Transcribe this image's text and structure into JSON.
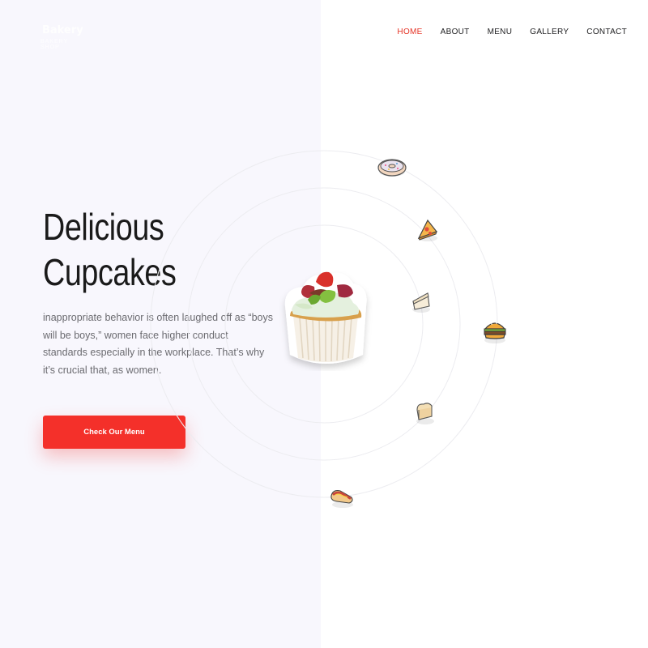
{
  "nav": {
    "items": [
      {
        "label": "HOME",
        "active": true
      },
      {
        "label": "ABOUT",
        "active": false
      },
      {
        "label": "MENU",
        "active": false
      },
      {
        "label": "GALLERY",
        "active": false
      },
      {
        "label": "CONTACT",
        "active": false
      }
    ]
  },
  "logo": {
    "word": "Bakery",
    "tagline": "BAKERY SHOP"
  },
  "hero": {
    "title_line1": "Delicious",
    "title_line2": "Cupcakes",
    "text": "inappropriate behavior is often laughed off as “boys will be boys,” women face higher conduct standards especially in the workplace. That’s why it’s crucial that, as women.",
    "cta_label": "Check Our Menu"
  },
  "icons": [
    "donut-icon",
    "pizza-icon",
    "cake-slice-icon",
    "burger-icon",
    "bread-icon",
    "hotdog-icon",
    "cupcake-image"
  ],
  "colors": {
    "accent": "#f4302a",
    "nav_active": "#e53224",
    "left_bg": "#f8f7fd",
    "text": "#1a1a1a",
    "muted": "#6b6b70"
  }
}
